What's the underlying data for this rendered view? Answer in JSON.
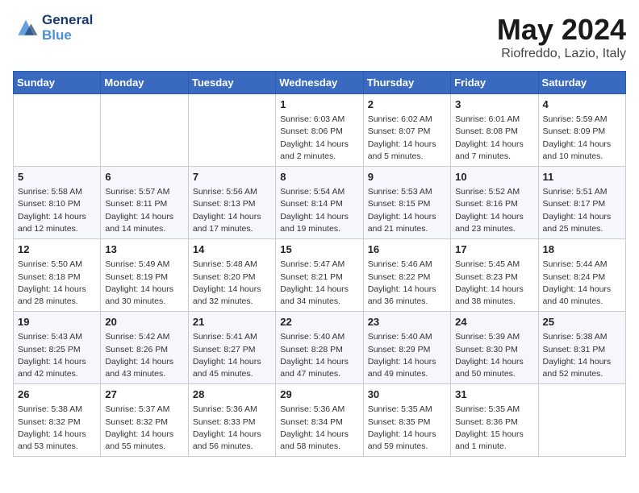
{
  "header": {
    "logo_line1": "General",
    "logo_line2": "Blue",
    "month": "May 2024",
    "location": "Riofreddo, Lazio, Italy"
  },
  "weekdays": [
    "Sunday",
    "Monday",
    "Tuesday",
    "Wednesday",
    "Thursday",
    "Friday",
    "Saturday"
  ],
  "weeks": [
    [
      {
        "day": "",
        "info": ""
      },
      {
        "day": "",
        "info": ""
      },
      {
        "day": "",
        "info": ""
      },
      {
        "day": "1",
        "info": "Sunrise: 6:03 AM\nSunset: 8:06 PM\nDaylight: 14 hours\nand 2 minutes."
      },
      {
        "day": "2",
        "info": "Sunrise: 6:02 AM\nSunset: 8:07 PM\nDaylight: 14 hours\nand 5 minutes."
      },
      {
        "day": "3",
        "info": "Sunrise: 6:01 AM\nSunset: 8:08 PM\nDaylight: 14 hours\nand 7 minutes."
      },
      {
        "day": "4",
        "info": "Sunrise: 5:59 AM\nSunset: 8:09 PM\nDaylight: 14 hours\nand 10 minutes."
      }
    ],
    [
      {
        "day": "5",
        "info": "Sunrise: 5:58 AM\nSunset: 8:10 PM\nDaylight: 14 hours\nand 12 minutes."
      },
      {
        "day": "6",
        "info": "Sunrise: 5:57 AM\nSunset: 8:11 PM\nDaylight: 14 hours\nand 14 minutes."
      },
      {
        "day": "7",
        "info": "Sunrise: 5:56 AM\nSunset: 8:13 PM\nDaylight: 14 hours\nand 17 minutes."
      },
      {
        "day": "8",
        "info": "Sunrise: 5:54 AM\nSunset: 8:14 PM\nDaylight: 14 hours\nand 19 minutes."
      },
      {
        "day": "9",
        "info": "Sunrise: 5:53 AM\nSunset: 8:15 PM\nDaylight: 14 hours\nand 21 minutes."
      },
      {
        "day": "10",
        "info": "Sunrise: 5:52 AM\nSunset: 8:16 PM\nDaylight: 14 hours\nand 23 minutes."
      },
      {
        "day": "11",
        "info": "Sunrise: 5:51 AM\nSunset: 8:17 PM\nDaylight: 14 hours\nand 25 minutes."
      }
    ],
    [
      {
        "day": "12",
        "info": "Sunrise: 5:50 AM\nSunset: 8:18 PM\nDaylight: 14 hours\nand 28 minutes."
      },
      {
        "day": "13",
        "info": "Sunrise: 5:49 AM\nSunset: 8:19 PM\nDaylight: 14 hours\nand 30 minutes."
      },
      {
        "day": "14",
        "info": "Sunrise: 5:48 AM\nSunset: 8:20 PM\nDaylight: 14 hours\nand 32 minutes."
      },
      {
        "day": "15",
        "info": "Sunrise: 5:47 AM\nSunset: 8:21 PM\nDaylight: 14 hours\nand 34 minutes."
      },
      {
        "day": "16",
        "info": "Sunrise: 5:46 AM\nSunset: 8:22 PM\nDaylight: 14 hours\nand 36 minutes."
      },
      {
        "day": "17",
        "info": "Sunrise: 5:45 AM\nSunset: 8:23 PM\nDaylight: 14 hours\nand 38 minutes."
      },
      {
        "day": "18",
        "info": "Sunrise: 5:44 AM\nSunset: 8:24 PM\nDaylight: 14 hours\nand 40 minutes."
      }
    ],
    [
      {
        "day": "19",
        "info": "Sunrise: 5:43 AM\nSunset: 8:25 PM\nDaylight: 14 hours\nand 42 minutes."
      },
      {
        "day": "20",
        "info": "Sunrise: 5:42 AM\nSunset: 8:26 PM\nDaylight: 14 hours\nand 43 minutes."
      },
      {
        "day": "21",
        "info": "Sunrise: 5:41 AM\nSunset: 8:27 PM\nDaylight: 14 hours\nand 45 minutes."
      },
      {
        "day": "22",
        "info": "Sunrise: 5:40 AM\nSunset: 8:28 PM\nDaylight: 14 hours\nand 47 minutes."
      },
      {
        "day": "23",
        "info": "Sunrise: 5:40 AM\nSunset: 8:29 PM\nDaylight: 14 hours\nand 49 minutes."
      },
      {
        "day": "24",
        "info": "Sunrise: 5:39 AM\nSunset: 8:30 PM\nDaylight: 14 hours\nand 50 minutes."
      },
      {
        "day": "25",
        "info": "Sunrise: 5:38 AM\nSunset: 8:31 PM\nDaylight: 14 hours\nand 52 minutes."
      }
    ],
    [
      {
        "day": "26",
        "info": "Sunrise: 5:38 AM\nSunset: 8:32 PM\nDaylight: 14 hours\nand 53 minutes."
      },
      {
        "day": "27",
        "info": "Sunrise: 5:37 AM\nSunset: 8:32 PM\nDaylight: 14 hours\nand 55 minutes."
      },
      {
        "day": "28",
        "info": "Sunrise: 5:36 AM\nSunset: 8:33 PM\nDaylight: 14 hours\nand 56 minutes."
      },
      {
        "day": "29",
        "info": "Sunrise: 5:36 AM\nSunset: 8:34 PM\nDaylight: 14 hours\nand 58 minutes."
      },
      {
        "day": "30",
        "info": "Sunrise: 5:35 AM\nSunset: 8:35 PM\nDaylight: 14 hours\nand 59 minutes."
      },
      {
        "day": "31",
        "info": "Sunrise: 5:35 AM\nSunset: 8:36 PM\nDaylight: 15 hours\nand 1 minute."
      },
      {
        "day": "",
        "info": ""
      }
    ]
  ]
}
